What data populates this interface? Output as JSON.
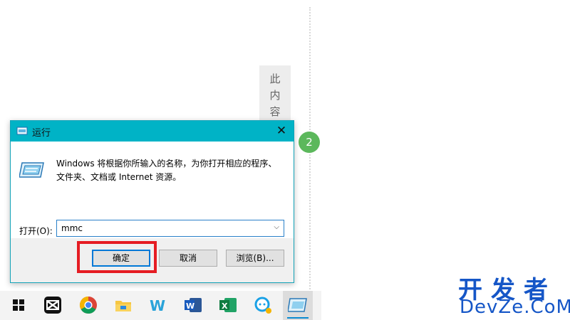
{
  "side_note": {
    "chars": [
      "此",
      "内",
      "容"
    ]
  },
  "step_badge": "2",
  "dialog": {
    "title": "运行",
    "close_glyph": "✕",
    "description_line1": "Windows 将根据你所输入的名称，为你打开相应的程序、",
    "description_line2": "文件夹、文档或 Internet 资源。",
    "open_label": "打开(O):",
    "open_value": "mmc",
    "buttons": {
      "ok": "确定",
      "cancel": "取消",
      "browse": "浏览(B)..."
    }
  },
  "taskbar": {
    "items": [
      {
        "icon": "windows-start-icon"
      },
      {
        "icon": "capcut-icon"
      },
      {
        "icon": "chrome-icon"
      },
      {
        "icon": "file-explorer-icon"
      },
      {
        "icon": "wps-writer-icon"
      },
      {
        "icon": "word-icon"
      },
      {
        "icon": "excel-icon"
      },
      {
        "icon": "chat-app-icon"
      },
      {
        "icon": "run-dialog-icon",
        "active": true
      }
    ]
  },
  "watermark": {
    "cn": "开发者",
    "en": "DevZe.CoM"
  },
  "colors": {
    "titlebar": "#00b3c6",
    "highlight": "#e51c23",
    "badge": "#5cb85c",
    "watermark": "#1556c7"
  }
}
